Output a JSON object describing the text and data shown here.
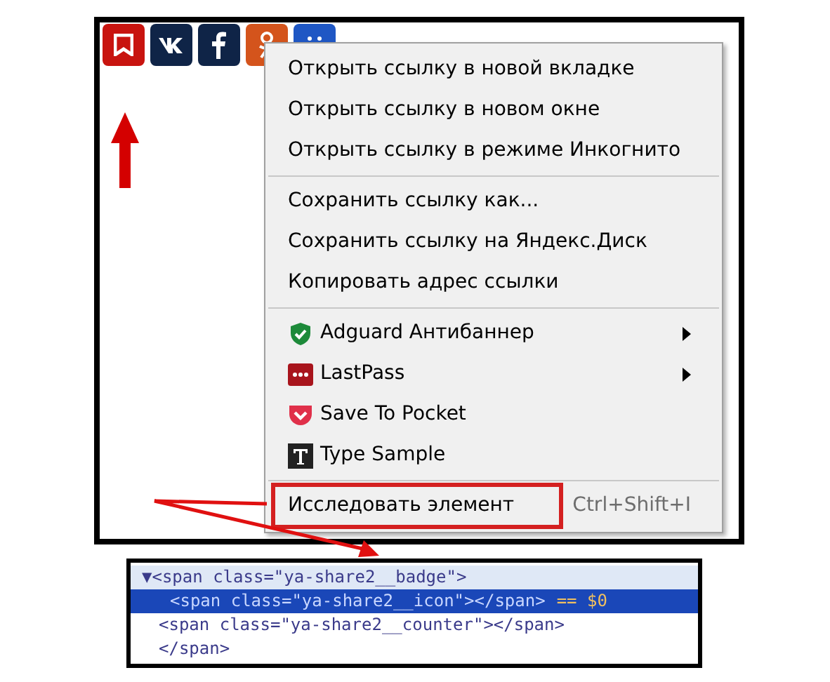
{
  "share_buttons": [
    {
      "kind": "bookmark"
    },
    {
      "kind": "vk"
    },
    {
      "kind": "facebook"
    },
    {
      "kind": "odnoklassniki"
    },
    {
      "kind": "more"
    }
  ],
  "context_menu": {
    "groups": [
      [
        {
          "label": "Открыть ссылку в новой вкладке"
        },
        {
          "label": "Открыть ссылку в новом окне"
        },
        {
          "label": "Открыть ссылку в режиме Инкогнито"
        }
      ],
      [
        {
          "label": "Сохранить ссылку как..."
        },
        {
          "label": "Сохранить ссылку на Яндекс.Диск"
        },
        {
          "label": "Копировать адрес ссылки"
        }
      ],
      [
        {
          "label": "Adguard Антибаннер",
          "kind": "shield",
          "submenu": true
        },
        {
          "label": "LastPass",
          "kind": "dots",
          "submenu": true
        },
        {
          "label": "Save To Pocket",
          "kind": "pocket",
          "submenu": false
        },
        {
          "label": "Type Sample",
          "kind": "type",
          "submenu": false
        }
      ],
      [
        {
          "label": "Исследовать элемент",
          "shortcut": "Ctrl+Shift+I",
          "outlined": true
        }
      ]
    ]
  },
  "devtools": {
    "lines": [
      {
        "toggle": "▼",
        "code": "<span class=\"ya-share2__badge\">",
        "selected": false
      },
      {
        "code": "<span class=\"ya-share2__icon\"></span>",
        "suffix": "== $0",
        "selected": true
      },
      {
        "code": "<span class=\"ya-share2__counter\"></span>",
        "selected": false
      },
      {
        "code": "</span>",
        "selected": false
      }
    ]
  }
}
